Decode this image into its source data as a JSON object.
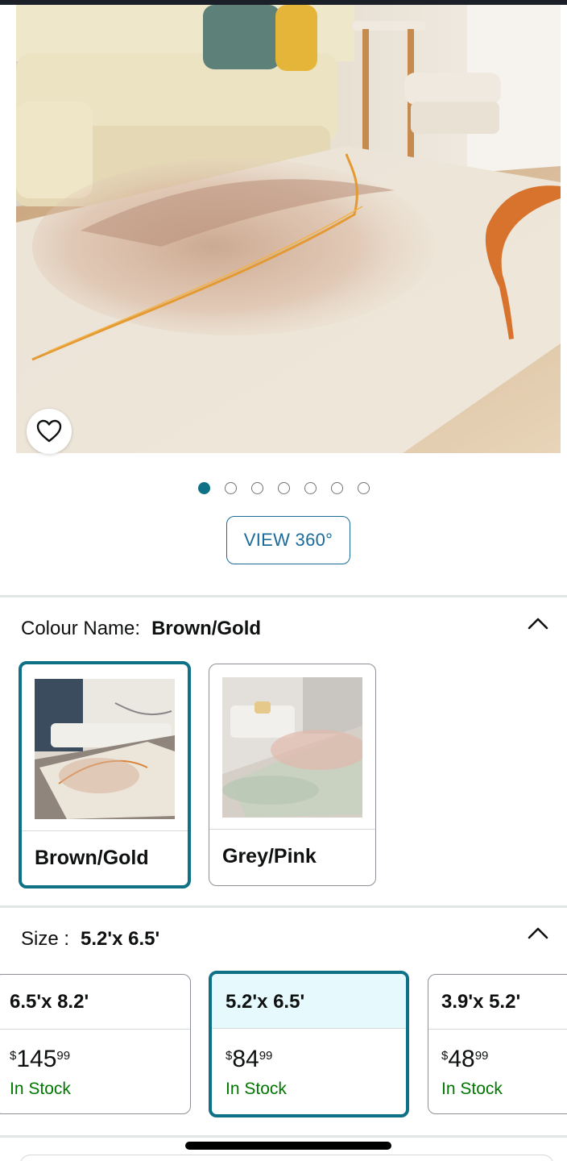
{
  "carousel": {
    "dot_count": 7,
    "active_index": 0
  },
  "view360_label": "VIEW 360°",
  "colour": {
    "label": "Colour Name:",
    "selected_value": "Brown/Gold",
    "options": [
      {
        "name": "Brown/Gold",
        "selected": true
      },
      {
        "name": "Grey/Pink",
        "selected": false
      }
    ]
  },
  "size": {
    "label": "Size :",
    "selected_value": "5.2'x 6.5'",
    "options": [
      {
        "size": "6.5'x 8.2'",
        "currency": "$",
        "whole": "145",
        "fraction": "99",
        "stock": "In Stock",
        "selected": false
      },
      {
        "size": "5.2'x 6.5'",
        "currency": "$",
        "whole": "84",
        "fraction": "99",
        "stock": "In Stock",
        "selected": true
      },
      {
        "size": "3.9'x 5.2'",
        "currency": "$",
        "whole": "48",
        "fraction": "99",
        "stock": "In Stock",
        "selected": false
      }
    ]
  },
  "icons": {
    "wishlist": "heart-icon",
    "collapse": "chevron-up-icon"
  },
  "colors": {
    "accent_teal": "#0f7185",
    "link_blue": "#1a6b9a",
    "in_stock_green": "#007600",
    "selected_bg": "#e6f9fc"
  }
}
